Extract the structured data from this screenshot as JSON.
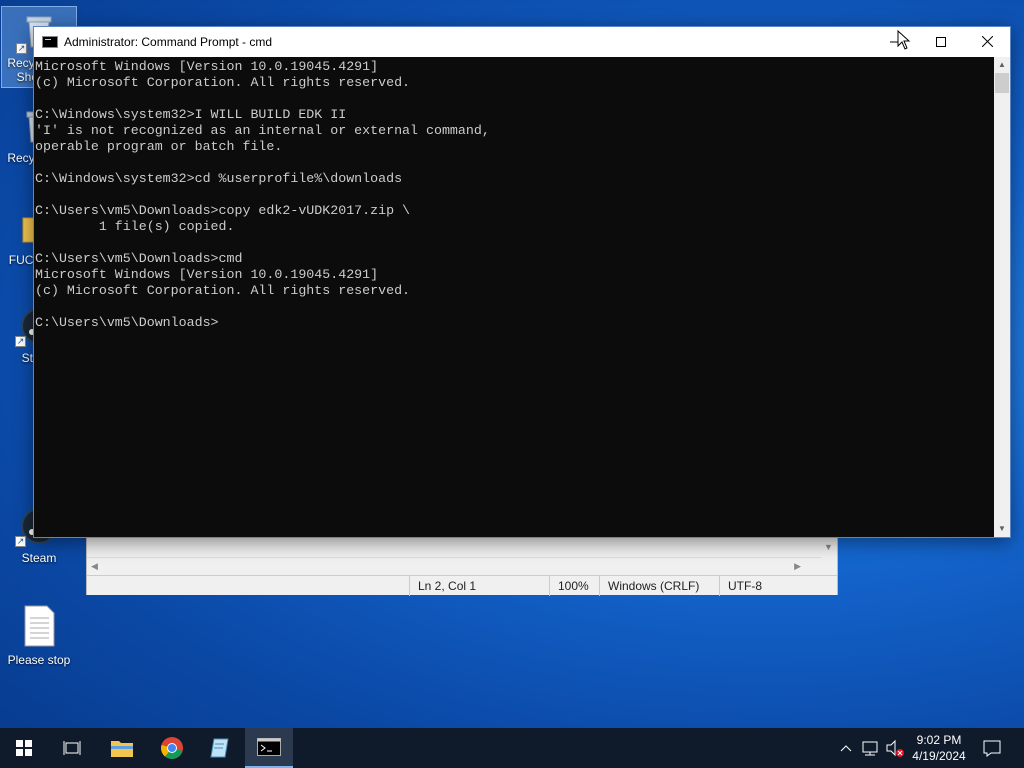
{
  "desktop": {
    "icons": [
      {
        "label": "Recycle Bin Shortcut",
        "icon": "recycle-bin-icon"
      },
      {
        "label": "Recycle Bin",
        "icon": "recycle-bin-icon"
      },
      {
        "label": "FUCK This",
        "icon": "folder-icon"
      },
      {
        "label": "Steam",
        "icon": "steam-icon"
      },
      {
        "label": "Steam",
        "icon": "steam-icon"
      },
      {
        "label": "Please stop",
        "icon": "text-file-icon"
      }
    ]
  },
  "cmd": {
    "title": "Administrator: Command Prompt - cmd",
    "lines": [
      "Microsoft Windows [Version 10.0.19045.4291]",
      "(c) Microsoft Corporation. All rights reserved.",
      "",
      "C:\\Windows\\system32>I WILL BUILD EDK II",
      "'I' is not recognized as an internal or external command,",
      "operable program or batch file.",
      "",
      "C:\\Windows\\system32>cd %userprofile%\\downloads",
      "",
      "C:\\Users\\vm5\\Downloads>copy edk2-vUDK2017.zip \\",
      "        1 file(s) copied.",
      "",
      "C:\\Users\\vm5\\Downloads>cmd",
      "Microsoft Windows [Version 10.0.19045.4291]",
      "(c) Microsoft Corporation. All rights reserved.",
      "",
      "C:\\Users\\vm5\\Downloads>"
    ],
    "colors": {
      "background": "#0c0c0c",
      "text": "#cccccc"
    }
  },
  "notepad": {
    "status": {
      "position": "Ln 2, Col 1",
      "zoom": "100%",
      "line_endings": "Windows (CRLF)",
      "encoding": "UTF-8"
    }
  },
  "taskbar": {
    "apps": [
      "start-icon",
      "task-view-icon",
      "file-explorer-icon",
      "chrome-icon",
      "notepad-icon",
      "command-prompt-icon"
    ],
    "active_app": "command-prompt-icon",
    "clock": {
      "time": "9:02 PM",
      "date": "4/19/2024"
    }
  }
}
